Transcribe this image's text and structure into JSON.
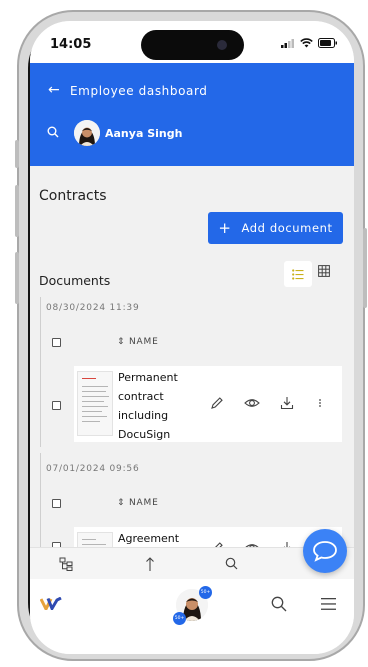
{
  "status_bar": {
    "time": "14:05"
  },
  "header": {
    "title": "Employee dashboard",
    "user_name": "Aanya Singh"
  },
  "page": {
    "section_title": "Contracts",
    "add_button_label": "Add document",
    "documents_title": "Documents"
  },
  "groups": [
    {
      "date": "08/30/2024 11:39",
      "column_name": "NAME",
      "document": {
        "lines": [
          "Permanent",
          "contract",
          "including",
          "DocuSign"
        ]
      }
    },
    {
      "date": "07/01/2024 09:56",
      "column_name": "NAME",
      "document": {
        "lines": [
          "Agreement"
        ]
      }
    }
  ],
  "bottom_nav": {
    "badge_top": "50+",
    "badge_bottom": "50+"
  },
  "colors": {
    "primary": "#2368e8",
    "background": "#f1f1f1",
    "fab": "#3b82f6"
  },
  "icons": [
    "back-arrow-icon",
    "search-icon",
    "list-view-icon",
    "grid-view-icon",
    "edit-icon",
    "view-icon",
    "download-icon",
    "more-icon",
    "tree-icon",
    "upload-icon",
    "chat-icon",
    "brand-logo-icon",
    "menu-icon"
  ]
}
